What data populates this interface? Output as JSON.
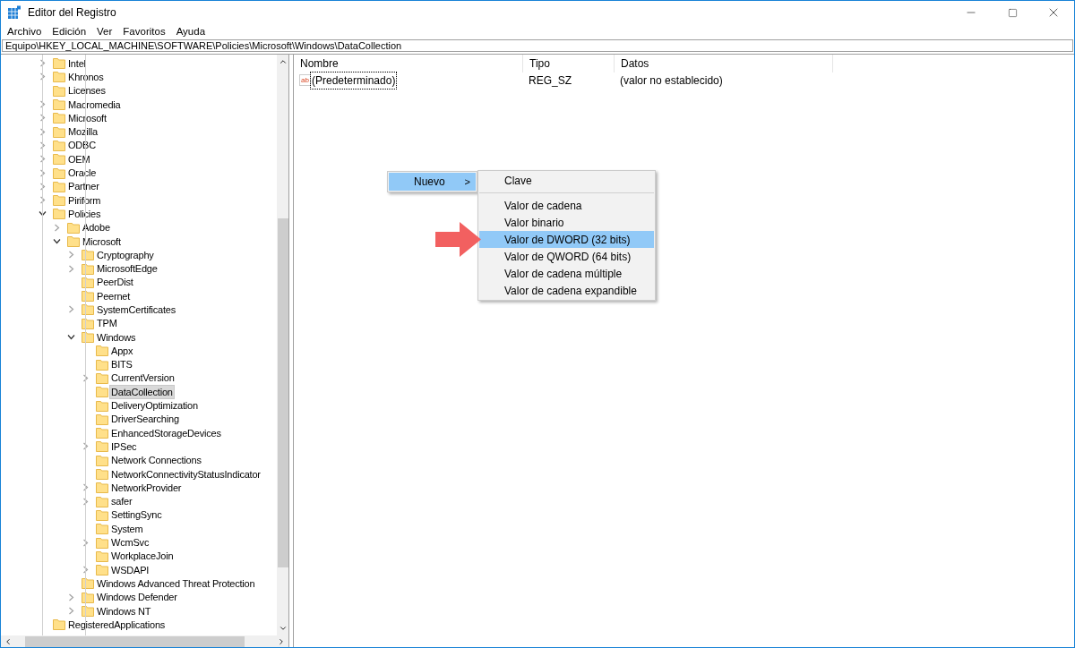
{
  "window": {
    "title": "Editor del Registro"
  },
  "menu_bar": [
    "Archivo",
    "Edición",
    "Ver",
    "Favoritos",
    "Ayuda"
  ],
  "address_bar": {
    "value": "Equipo\\HKEY_LOCAL_MACHINE\\SOFTWARE\\Policies\\Microsoft\\Windows\\DataCollection"
  },
  "tree": [
    {
      "label": "Intel",
      "expanded": false,
      "selected": false
    },
    {
      "label": "Khronos",
      "expanded": false,
      "selected": false
    },
    {
      "label": "Licenses",
      "selected": false
    },
    {
      "label": "Macromedia",
      "expanded": false,
      "selected": false
    },
    {
      "label": "Microsoft",
      "expanded": false,
      "selected": false
    },
    {
      "label": "Mozilla",
      "expanded": false,
      "selected": false
    },
    {
      "label": "ODBC",
      "expanded": false,
      "selected": false
    },
    {
      "label": "OEM",
      "expanded": false,
      "selected": false
    },
    {
      "label": "Oracle",
      "expanded": false,
      "selected": false
    },
    {
      "label": "Partner",
      "expanded": false,
      "selected": false
    },
    {
      "label": "Piriform",
      "expanded": false,
      "selected": false
    },
    {
      "label": "Policies",
      "expanded": true,
      "selected": false,
      "children": [
        {
          "label": "Adobe",
          "expanded": false,
          "selected": false
        },
        {
          "label": "Microsoft",
          "expanded": true,
          "selected": false,
          "children": [
            {
              "label": "Cryptography",
              "expanded": false,
              "selected": false
            },
            {
              "label": "MicrosoftEdge",
              "expanded": false,
              "selected": false
            },
            {
              "label": "PeerDist",
              "selected": false
            },
            {
              "label": "Peernet",
              "selected": false
            },
            {
              "label": "SystemCertificates",
              "expanded": false,
              "selected": false
            },
            {
              "label": "TPM",
              "selected": false
            },
            {
              "label": "Windows",
              "expanded": true,
              "selected": false,
              "children": [
                {
                  "label": "Appx",
                  "selected": false
                },
                {
                  "label": "BITS",
                  "selected": false
                },
                {
                  "label": "CurrentVersion",
                  "expanded": false,
                  "selected": false
                },
                {
                  "label": "DataCollection",
                  "selected": true
                },
                {
                  "label": "DeliveryOptimization",
                  "selected": false
                },
                {
                  "label": "DriverSearching",
                  "selected": false
                },
                {
                  "label": "EnhancedStorageDevices",
                  "selected": false
                },
                {
                  "label": "IPSec",
                  "expanded": false,
                  "selected": false
                },
                {
                  "label": "Network Connections",
                  "selected": false
                },
                {
                  "label": "NetworkConnectivityStatusIndicator",
                  "selected": false
                },
                {
                  "label": "NetworkProvider",
                  "expanded": false,
                  "selected": false
                },
                {
                  "label": "safer",
                  "expanded": false,
                  "selected": false
                },
                {
                  "label": "SettingSync",
                  "selected": false
                },
                {
                  "label": "System",
                  "selected": false
                },
                {
                  "label": "WcmSvc",
                  "expanded": false,
                  "selected": false
                },
                {
                  "label": "WorkplaceJoin",
                  "selected": false
                },
                {
                  "label": "WSDAPI",
                  "expanded": false,
                  "selected": false
                }
              ]
            },
            {
              "label": "Windows Advanced Threat Protection",
              "selected": false
            },
            {
              "label": "Windows Defender",
              "expanded": false,
              "selected": false
            },
            {
              "label": "Windows NT",
              "expanded": false,
              "selected": false
            }
          ]
        }
      ]
    },
    {
      "label": "RegisteredApplications",
      "selected": false
    }
  ],
  "list": {
    "columns": [
      "Nombre",
      "Tipo",
      "Datos"
    ],
    "rows": [
      {
        "icon_text": "ab",
        "name": "(Predeterminado)",
        "type": "REG_SZ",
        "data": "(valor no establecido)",
        "selected": true
      }
    ]
  },
  "context_menu": {
    "items": [
      {
        "label": "Nuevo",
        "selected": true,
        "submenu_marker": ">"
      }
    ],
    "submenu": [
      {
        "label": "Clave",
        "selected": false,
        "separator_after": true
      },
      {
        "label": "Valor de cadena",
        "selected": false,
        "separator_after": false
      },
      {
        "label": "Valor binario",
        "selected": false,
        "separator_after": false
      },
      {
        "label": "Valor de DWORD (32 bits)",
        "selected": true,
        "separator_after": false
      },
      {
        "label": "Valor de QWORD (64 bits)",
        "selected": false,
        "separator_after": false
      },
      {
        "label": "Valor de cadena múltiple",
        "selected": false,
        "separator_after": false
      },
      {
        "label": "Valor de cadena expandible",
        "selected": false,
        "separator_after": false
      }
    ]
  }
}
